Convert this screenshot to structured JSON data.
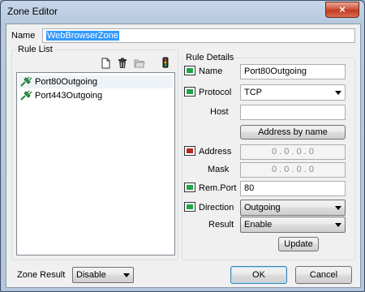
{
  "window": {
    "title": "Zone Editor",
    "close_glyph": "×"
  },
  "zone": {
    "name_label": "Name",
    "name_value": "WebBrowserZone"
  },
  "rule_list": {
    "label": "Rule List",
    "items": [
      {
        "label": "Port80Outgoing",
        "icon": "plug-allowed-icon",
        "selected": true
      },
      {
        "label": "Port443Outgoing",
        "icon": "plug-allowed-icon",
        "selected": false
      }
    ],
    "toolbar": [
      "new-document-icon",
      "trash-icon",
      "open-folder-icon",
      "traffic-light-icon"
    ]
  },
  "rule_details": {
    "label": "Rule Details",
    "name_label": "Name",
    "name_value": "Port80Outgoing",
    "protocol_label": "Protocol",
    "protocol_value": "TCP",
    "host_label": "Host",
    "host_value": "",
    "address_by_name_label": "Address by name",
    "address_label": "Address",
    "address_value": "0 . 0 . 0 . 0",
    "mask_label": "Mask",
    "mask_value": "0 . 0 . 0 . 0",
    "remport_label": "Rem.Port",
    "remport_value": "80",
    "direction_label": "Direction",
    "direction_value": "Outgoing",
    "result_label": "Result",
    "result_value": "Enable",
    "update_label": "Update"
  },
  "footer": {
    "zone_result_label": "Zone Result",
    "zone_result_value": "Disable",
    "ok_label": "OK",
    "cancel_label": "Cancel"
  },
  "colors": {
    "enabled": "#1fa34a",
    "disabled": "#b22a23",
    "selection": "#3399ff"
  }
}
